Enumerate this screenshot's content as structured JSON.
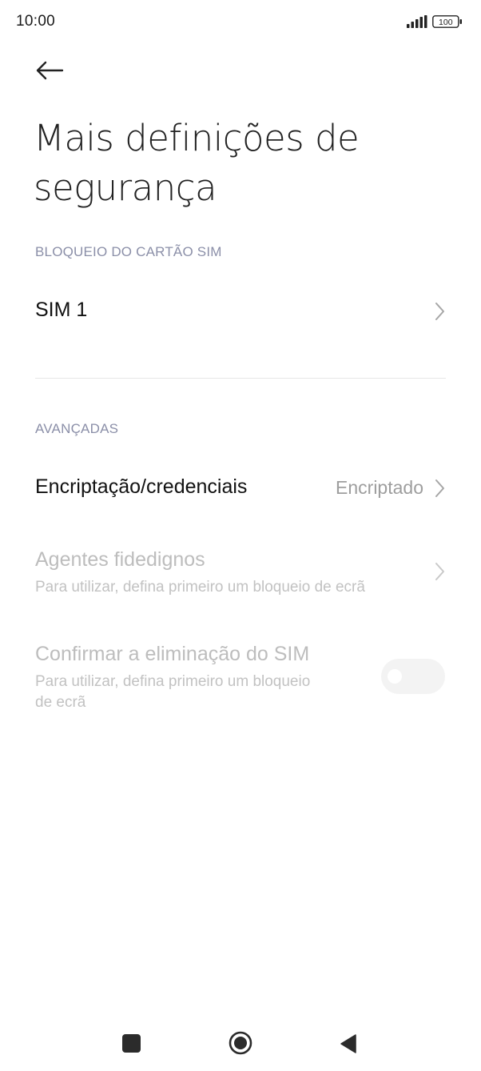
{
  "status_bar": {
    "time": "10:00",
    "battery": "100",
    "icons": [
      "signal-icon",
      "battery-icon"
    ]
  },
  "header": {
    "back_icon": "arrow-left-icon",
    "title": "Mais definições de segurança"
  },
  "sections": {
    "sim_lock": {
      "header": "BLOQUEIO DO CARTÃO SIM",
      "items": [
        {
          "title": "SIM 1",
          "icon": "chevron-right-icon"
        }
      ]
    },
    "advanced": {
      "header": "AVANÇADAS",
      "items": [
        {
          "title": "Encriptação/credenciais",
          "value": "Encriptado",
          "icon": "chevron-right-icon"
        },
        {
          "title": "Agentes fidedignos",
          "subtitle": "Para utilizar, defina primeiro um bloqueio de ecrã",
          "icon": "chevron-right-icon",
          "enabled": false
        },
        {
          "title": "Confirmar a eliminação do SIM",
          "subtitle_line1": "Para utilizar, defina primeiro um bloqueio",
          "subtitle_line2": "de ecrã",
          "toggle": false,
          "enabled": false
        }
      ]
    }
  },
  "nav_bar": {
    "icons": [
      "recents-square-icon",
      "home-circle-icon",
      "back-triangle-icon"
    ]
  },
  "colors": {
    "section_header": "#8b8fa8",
    "disabled_text": "#bdbdbd",
    "value_text": "#9e9e9e"
  }
}
